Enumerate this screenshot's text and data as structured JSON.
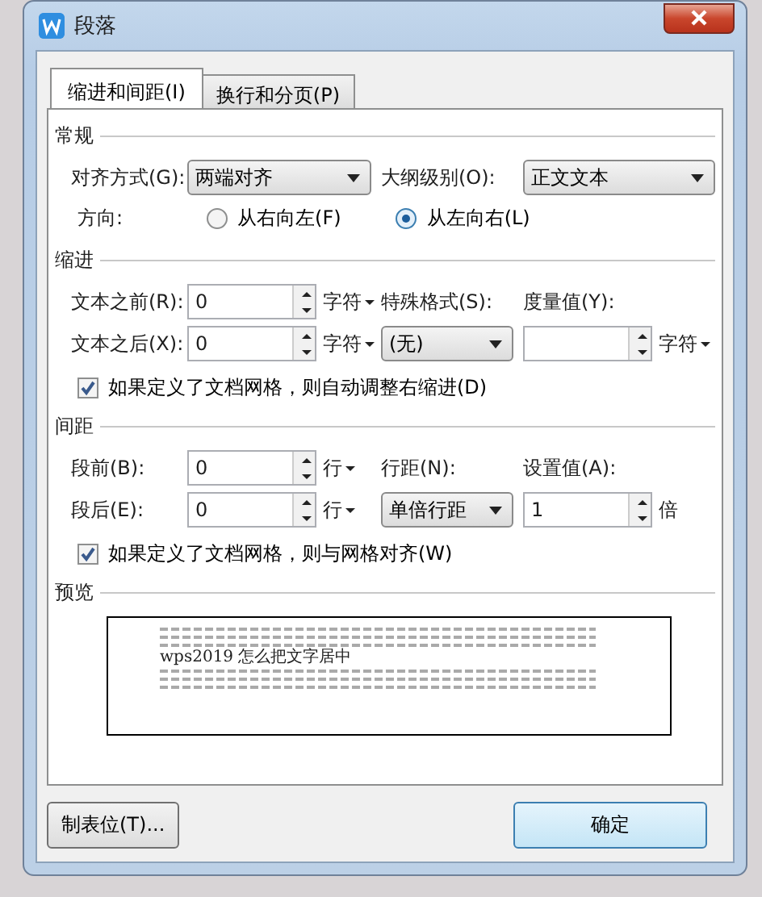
{
  "window": {
    "title": "段落"
  },
  "tabs": [
    {
      "label": "缩进和间距(I)",
      "selected": true
    },
    {
      "label": "换行和分页(P)",
      "selected": false
    }
  ],
  "general": {
    "heading": "常规",
    "alignment": {
      "label": "对齐方式(G):",
      "value": "两端对齐"
    },
    "outline_level": {
      "label": "大纲级别(O):",
      "value": "正文文本"
    },
    "direction": {
      "label": "方向:",
      "options": [
        {
          "label": "从右向左(F)",
          "selected": false
        },
        {
          "label": "从左向右(L)",
          "selected": true
        }
      ]
    }
  },
  "indent": {
    "heading": "缩进",
    "before_text": {
      "label": "文本之前(R):",
      "value": "0",
      "unit": "字符"
    },
    "after_text": {
      "label": "文本之后(X):",
      "value": "0",
      "unit": "字符"
    },
    "special_format": {
      "label": "特殊格式(S):",
      "value": "(无)"
    },
    "measure": {
      "label": "度量值(Y):",
      "unit": "字符"
    },
    "auto_adjust": {
      "label": "如果定义了文档网格，则自动调整右缩进(D)",
      "checked": true
    }
  },
  "spacing": {
    "heading": "间距",
    "before": {
      "label": "段前(B):",
      "value": "0",
      "unit": "行"
    },
    "after": {
      "label": "段后(E):",
      "value": "0",
      "unit": "行"
    },
    "line_spacing": {
      "label": "行距(N):",
      "value": "单倍行距"
    },
    "setting": {
      "label": "设置值(A):",
      "value": "1",
      "unit": "倍"
    },
    "snap_to_grid": {
      "label": "如果定义了文档网格，则与网格对齐(W)",
      "checked": true
    }
  },
  "preview": {
    "heading": "预览",
    "sample_text": "wps2019 怎么把文字居中"
  },
  "buttons": [
    {
      "label": "制表位(T)...",
      "kind": "normal"
    },
    {
      "label": "确定",
      "kind": "default"
    }
  ]
}
